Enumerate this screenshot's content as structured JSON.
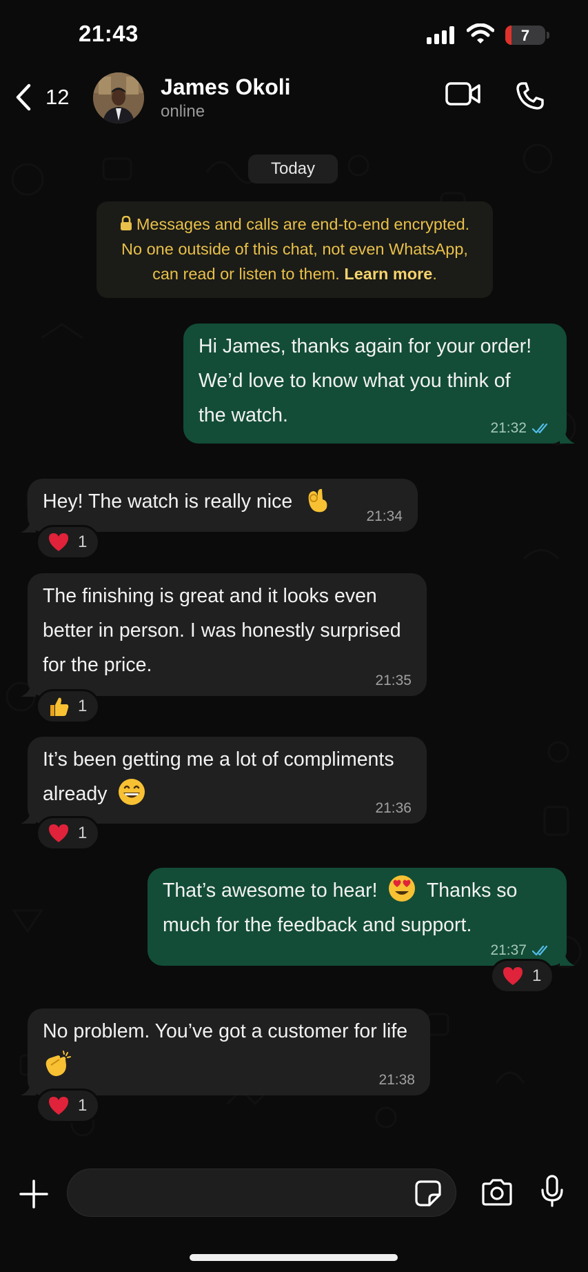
{
  "status_bar": {
    "time": "21:43",
    "battery_level": "7"
  },
  "header": {
    "back_count": "12",
    "contact_name": "James Okoli",
    "contact_status": "online"
  },
  "date_chip": "Today",
  "encryption_notice": {
    "line1": "Messages and calls are end-to-end encrypted.",
    "line2": "No one outside of this chat, not even WhatsApp,",
    "line3_text": "can read or listen to them. ",
    "learn_more": "Learn more",
    "line3_end": "."
  },
  "messages": [
    {
      "direction": "outgoing",
      "lines": [
        "Hi James, thanks again for your order!",
        "We’d love to know what you think of",
        "the watch."
      ],
      "time": "21:32",
      "status": "read"
    },
    {
      "direction": "incoming",
      "lines": [
        "Hey! The watch is really nice"
      ],
      "emoji": "ok-hand",
      "time": "21:34",
      "reaction": {
        "emoji": "red-heart",
        "count": "1"
      }
    },
    {
      "direction": "incoming",
      "lines": [
        "The finishing is great and it looks even",
        "better in person. I was honestly surprised",
        "for the price."
      ],
      "time": "21:35",
      "reaction": {
        "emoji": "thumbs-up",
        "count": "1"
      }
    },
    {
      "direction": "incoming",
      "lines": [
        "It’s been getting me a lot of compliments",
        "already"
      ],
      "emoji": "grinning-face",
      "time": "21:36",
      "reaction": {
        "emoji": "red-heart",
        "count": "1"
      }
    },
    {
      "direction": "outgoing",
      "lines": [
        "That’s awesome to hear!",
        "Thanks so",
        "much for the feedback and support."
      ],
      "emoji": "heart-eyes",
      "time": "21:37",
      "status": "read",
      "reaction": {
        "emoji": "red-heart",
        "count": "1"
      }
    },
    {
      "direction": "incoming",
      "lines": [
        "No problem. You’ve got a customer for life"
      ],
      "emoji": "clapping-hands",
      "time": "21:38",
      "reaction": {
        "emoji": "red-heart",
        "count": "1"
      }
    }
  ],
  "composer": {
    "placeholder": ""
  },
  "colors": {
    "background": "#0b0b0b",
    "incoming_bubble": "#202020",
    "outgoing_bubble": "#134d37",
    "read_ticks": "#53bdeb",
    "encryption_text": "#e8c04a"
  },
  "icons": {
    "back": "chevron-left-icon",
    "video": "video-camera-icon",
    "call": "phone-icon",
    "plus": "plus-icon",
    "sticker": "sticker-icon",
    "camera": "camera-icon",
    "mic": "microphone-icon"
  }
}
